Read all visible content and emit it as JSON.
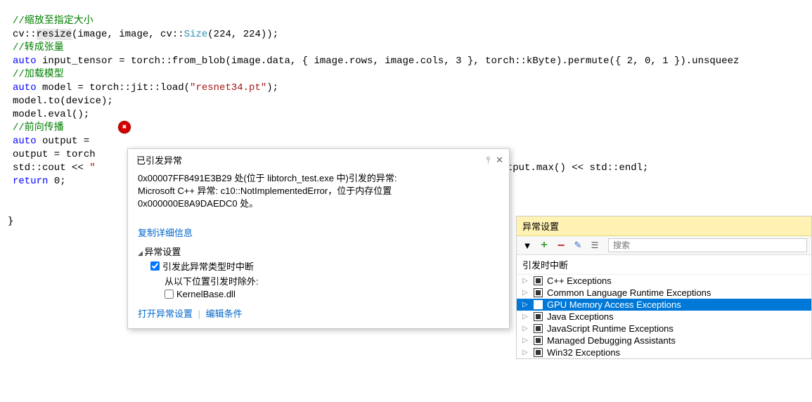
{
  "code": {
    "l1": "//缩放至指定大小",
    "l2_p1": "cv::",
    "l2_p2": "resize",
    "l2_p3": "(image, image, cv::",
    "l2_p4": "Size",
    "l2_p5": "(224, 224));",
    "l3": "//转成张量",
    "l4_p1": "auto",
    "l4_p2": " input_tensor = torch::from_blob(image.data, { image.rows, image.cols, 3 }, torch::kByte).permute({ 2, 0, 1 }).unsqueez",
    "l5": "//加载模型",
    "l6_p1": "auto",
    "l6_p2": " model = torch::jit::load(",
    "l6_p3": "\"resnet34.pt\"",
    "l6_p4": ");",
    "l7": "model.to(device);",
    "l8": "model.eval();",
    "l9": "//前向传播",
    "l10_p1": "auto",
    "l10_p2": " output = ",
    "l11": "output = torch",
    "l12_p1": "std::cout << ",
    "l12_p2": "\"",
    "l12_p3": " output.max() << std::endl;",
    "l13_p1": "return",
    "l13_p2": " 0;",
    "l14": "}"
  },
  "popup": {
    "title": "已引发异常",
    "msg_line1": "0x00007FF8491E3B29 处(位于 libtorch_test.exe 中)引发的异常:",
    "msg_line2": "Microsoft C++ 异常: c10::NotImplementedError，位于内存位置",
    "msg_line3": "0x000000E8A9DAEDC0 处。",
    "copy_details": "复制详细信息",
    "settings_header": "异常设置",
    "break_when_thrown": "引发此异常类型时中断",
    "except_from": "从以下位置引发时除外:",
    "kernel_dll": "KernelBase.dll",
    "open_settings": "打开异常设置",
    "edit_conditions": "编辑条件"
  },
  "settings_panel": {
    "title": "异常设置",
    "search_placeholder": "搜索",
    "col_header": "引发时中断",
    "items": [
      {
        "label": "C++ Exceptions"
      },
      {
        "label": "Common Language Runtime Exceptions"
      },
      {
        "label": "GPU Memory Access Exceptions"
      },
      {
        "label": "Java Exceptions"
      },
      {
        "label": "JavaScript Runtime Exceptions"
      },
      {
        "label": "Managed Debugging Assistants"
      },
      {
        "label": "Win32 Exceptions"
      }
    ]
  }
}
